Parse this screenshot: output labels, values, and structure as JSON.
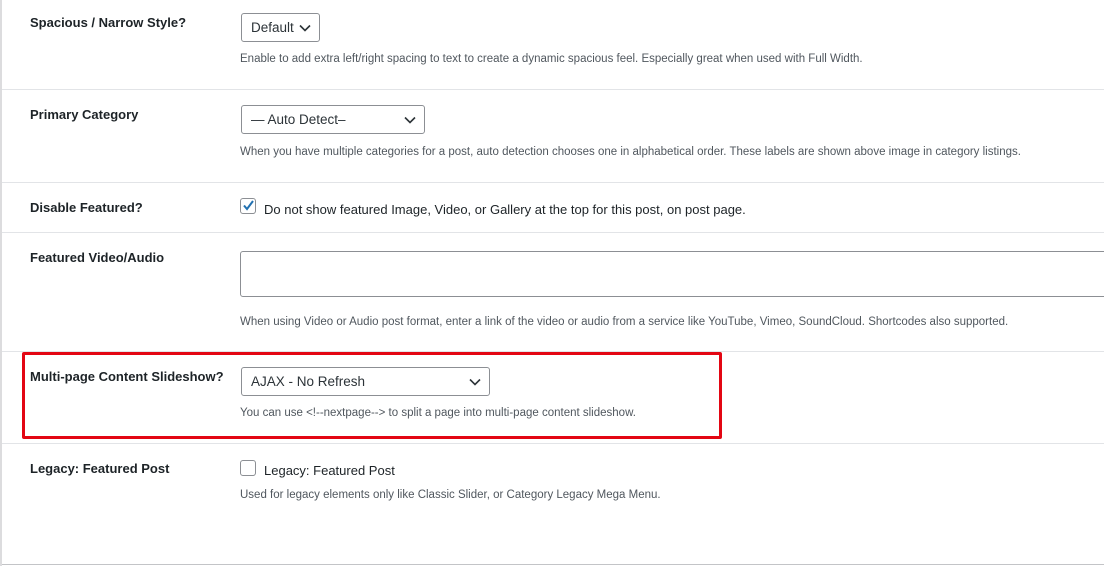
{
  "settings": {
    "spacious": {
      "label": "Spacious / Narrow Style?",
      "selected": "Default",
      "description": "Enable to add extra left/right spacing to text to create a dynamic spacious feel. Especially great when used with Full Width."
    },
    "primary_category": {
      "label": "Primary Category",
      "selected": "— Auto Detect–",
      "description": "When you have multiple categories for a post, auto detection chooses one in alphabetical order. These labels are shown above image in category listings."
    },
    "disable_featured": {
      "label": "Disable Featured?",
      "checked": true,
      "checkbox_label": "Do not show featured Image, Video, or Gallery at the top for this post, on post page."
    },
    "featured_video": {
      "label": "Featured Video/Audio",
      "value": "",
      "description": "When using Video or Audio post format, enter a link of the video or audio from a service like YouTube, Vimeo, SoundCloud. Shortcodes also supported."
    },
    "slideshow": {
      "label": "Multi-page Content Slideshow?",
      "selected": "AJAX - No Refresh",
      "description": "You can use <!--nextpage--> to split a page into multi-page content slideshow.",
      "highlight_color": "#e30613"
    },
    "legacy": {
      "label": "Legacy: Featured Post",
      "checked": false,
      "checkbox_label": "Legacy: Featured Post",
      "description": "Used for legacy elements only like Classic Slider, or Category Legacy Mega Menu."
    }
  }
}
